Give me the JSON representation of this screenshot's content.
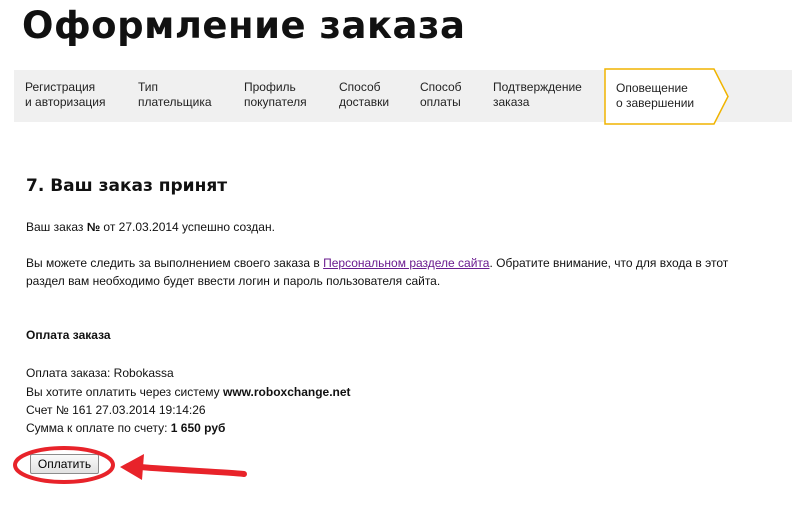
{
  "page": {
    "title": "Оформление заказа"
  },
  "steps": [
    {
      "line1": "Регистрация",
      "line2": "и авторизация"
    },
    {
      "line1": "Тип",
      "line2": "плательщика"
    },
    {
      "line1": "Профиль",
      "line2": "покупателя"
    },
    {
      "line1": "Способ",
      "line2": "доставки"
    },
    {
      "line1": "Способ",
      "line2": "оплаты"
    },
    {
      "line1": "Подтверждение",
      "line2": "заказа"
    },
    {
      "line1": "Оповещение",
      "line2": "о завершении",
      "active": true
    }
  ],
  "order": {
    "heading": "7. Ваш заказ принят",
    "created_prefix": "Ваш заказ ",
    "number_sign": "№",
    "created_suffix": " от 27.03.2014 успешно создан.",
    "info_text1": "Вы можете следить за выполнением своего заказа в ",
    "info_link": "Персональном разделе сайта",
    "info_text2": ". Обратите внимание, что для входа в этот",
    "info_line2": "раздел вам необходимо будет ввести логин и пароль пользователя сайта."
  },
  "payment": {
    "heading": "Оплата заказа",
    "method_line": "Оплата заказа: Robokassa",
    "system_prefix": "Вы хотите оплатить через систему ",
    "system_name": "www.roboxchange.net",
    "invoice_line": "Счет № 161 27.03.2014 19:14:26",
    "sum_prefix": "Сумма к оплате по счету: ",
    "sum_value": "1 650 руб",
    "button_label": "Оплатить"
  },
  "annotation": {
    "color": "#e8232a"
  },
  "colors": {
    "accent": "#f0b400",
    "link": "#6a1b8f",
    "bar_bg": "#f0f0f0"
  }
}
